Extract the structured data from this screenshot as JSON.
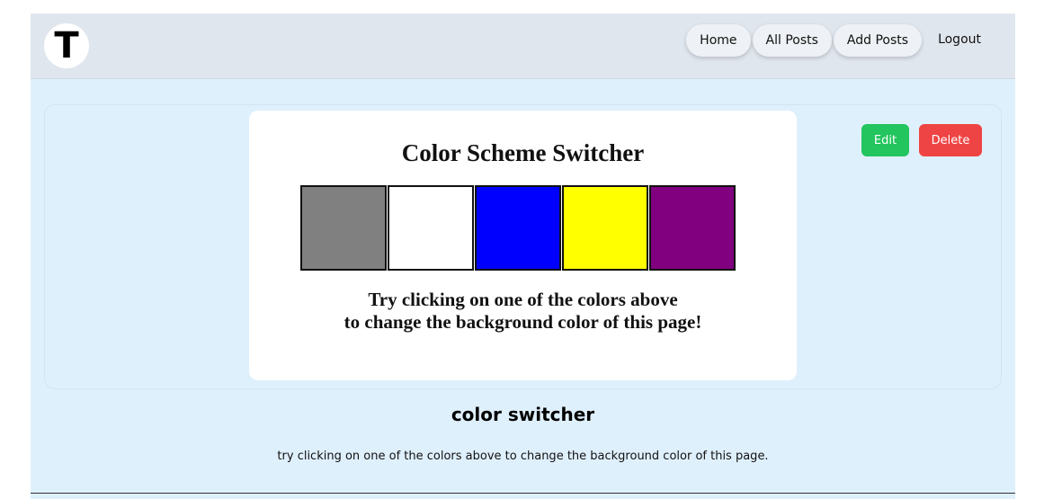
{
  "navbar": {
    "logo_letter": "T",
    "links": [
      {
        "label": "Home"
      },
      {
        "label": "All Posts"
      },
      {
        "label": "Add Posts"
      },
      {
        "label": "Logout"
      }
    ]
  },
  "post": {
    "preview": {
      "title": "Color Scheme Switcher",
      "swatches": [
        {
          "color": "#808080"
        },
        {
          "color": "#ffffff"
        },
        {
          "color": "#0000ff"
        },
        {
          "color": "#ffff00"
        },
        {
          "color": "#800080"
        }
      ],
      "instruction_line1": "Try clicking on one of the colors above",
      "instruction_line2": "to change the background color of this page!"
    },
    "actions": {
      "edit_label": "Edit",
      "delete_label": "Delete"
    },
    "title": "color switcher",
    "description": "try clicking on one of the colors above to change the background color of this page."
  },
  "colors": {
    "page_background": "#dff0fd",
    "navbar_background": "#e0e6ee",
    "edit_button": "#22c55e",
    "delete_button": "#ef4444"
  }
}
